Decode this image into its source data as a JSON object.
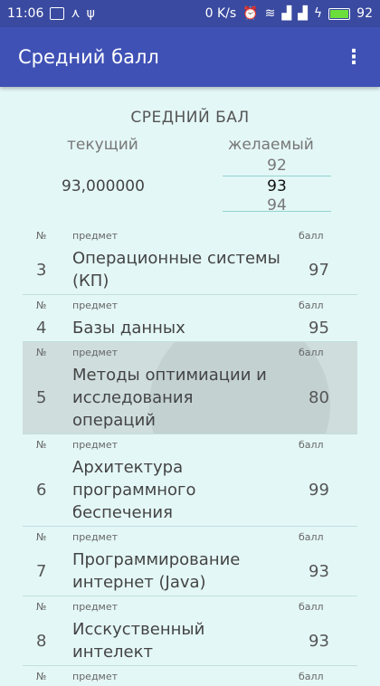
{
  "status_bar": {
    "time": "11:06",
    "data_speed": "0 K/s",
    "battery": "92"
  },
  "app_bar": {
    "title": "Средний балл",
    "menu_icon": "more-vert-icon"
  },
  "summary": {
    "title": "СРЕДНИЙ БАЛ",
    "current_label": "текущий",
    "desired_label": "желаемый",
    "current_value": "93,000000",
    "desired_picker": {
      "prev": "92",
      "selected": "93",
      "next": "94"
    }
  },
  "table_header": {
    "num": "№",
    "subject": "предмет",
    "score": "балл"
  },
  "subjects": [
    {
      "num": "3",
      "name": "Операционные системы (КП)",
      "score": "97"
    },
    {
      "num": "4",
      "name": "Базы данных",
      "score": "95"
    },
    {
      "num": "5",
      "name": "Методы оптимиации и исследования операций",
      "score": "80"
    },
    {
      "num": "6",
      "name": "Архитектура программного беспечения",
      "score": "99"
    },
    {
      "num": "7",
      "name": "Программирование интернет (Java)",
      "score": "93"
    },
    {
      "num": "8",
      "name": "Исскуственный интелект",
      "score": "93"
    }
  ]
}
